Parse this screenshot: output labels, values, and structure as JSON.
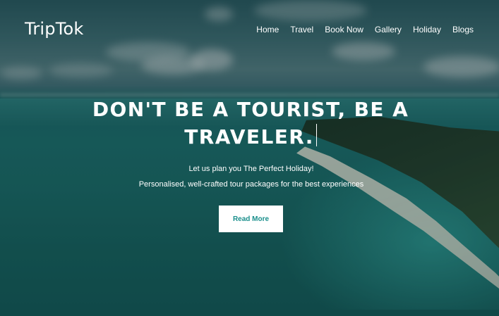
{
  "brand": {
    "name": "TripTok"
  },
  "nav": {
    "items": [
      {
        "label": "Home"
      },
      {
        "label": "Travel"
      },
      {
        "label": "Book Now"
      },
      {
        "label": "Gallery"
      },
      {
        "label": "Holiday"
      },
      {
        "label": "Blogs"
      }
    ]
  },
  "hero": {
    "headline_line1": "DON'T BE A TOURIST, BE A",
    "headline_line2": "TRAVELER.",
    "subtitle": "Let us plan you The Perfect Holiday!",
    "tagline": "Personalised, well-crafted tour packages for the best experiences",
    "cta_label": "Read More"
  },
  "colors": {
    "accent": "#1a8f8c",
    "text": "#ffffff",
    "sea": "#1b6b68"
  }
}
